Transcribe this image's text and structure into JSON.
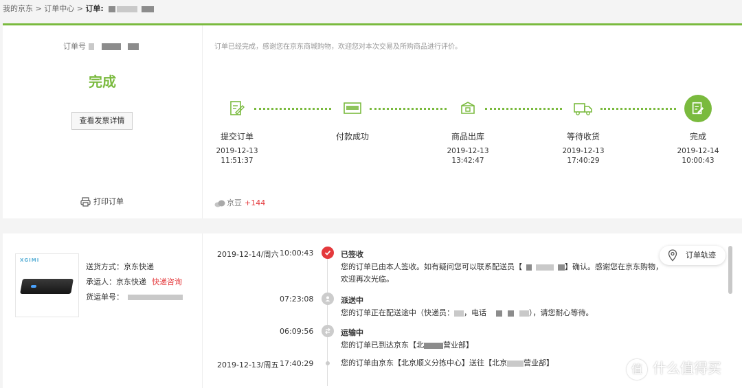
{
  "breadcrumb": {
    "home": "我的京东",
    "sep1": " > ",
    "center": "订单中心",
    "sep2": " > ",
    "current_label": "订单:"
  },
  "order": {
    "no_label": "订单号",
    "status": "完成",
    "invoice_button": "查看发票详情",
    "print_label": "打印订单"
  },
  "progress": {
    "notice": "订单已经完成，感谢您在京东商城购物，欢迎您对本次交易及所购商品进行评价。",
    "steps": [
      {
        "label": "提交订单",
        "date": "2019-12-13",
        "time": "11:51:37",
        "icon": "edit-doc-icon"
      },
      {
        "label": "付款成功",
        "date": "",
        "time": "",
        "icon": "payment-card-icon"
      },
      {
        "label": "商品出库",
        "date": "2019-12-13",
        "time": "13:42:47",
        "icon": "package-icon"
      },
      {
        "label": "等待收货",
        "date": "2019-12-13",
        "time": "17:40:29",
        "icon": "truck-icon"
      },
      {
        "label": "完成",
        "date": "2019-12-14",
        "time": "10:00:43",
        "icon": "complete-doc-icon"
      }
    ],
    "beans_label": "京豆",
    "beans_value": "+144",
    "accent": "#7aba3e"
  },
  "shipping": {
    "product_brand": "XGIMI",
    "method_label": "送货方式：",
    "method_value": "京东快递",
    "carrier_label": "承运人：",
    "carrier_value": "京东快递",
    "consult_link": "快递咨询",
    "waybill_label": "货运单号："
  },
  "tracking": {
    "button_label": "订单轨迹",
    "events": [
      {
        "date": "2019-12-14/周六",
        "time": "10:00:43",
        "title": "已签收",
        "desc": "您的订单已由本人签收。如有疑问您可以联系配送员【",
        "desc_tail": "】确认。感谢您在京东购物，欢迎再次光临。"
      },
      {
        "date": "",
        "time": "07:23:08",
        "title": "派送中",
        "desc": "您的订单正在配送途中（快递员：",
        "desc_mid": "，电话",
        "desc_tail": "），请您耐心等待。"
      },
      {
        "date": "",
        "time": "06:09:56",
        "title": "运输中",
        "desc": "您的订单已到达京东【北",
        "desc_tail": "营业部】"
      },
      {
        "date": "2019-12-13/周五",
        "time": "17:40:29",
        "title": "",
        "desc": "您的订单由京东【北京顺义分拣中心】送往【北京",
        "desc_tail": "营业部】"
      }
    ],
    "status_color": "#e4393c"
  },
  "watermark": {
    "text": "什么值得买",
    "mark": "值"
  }
}
